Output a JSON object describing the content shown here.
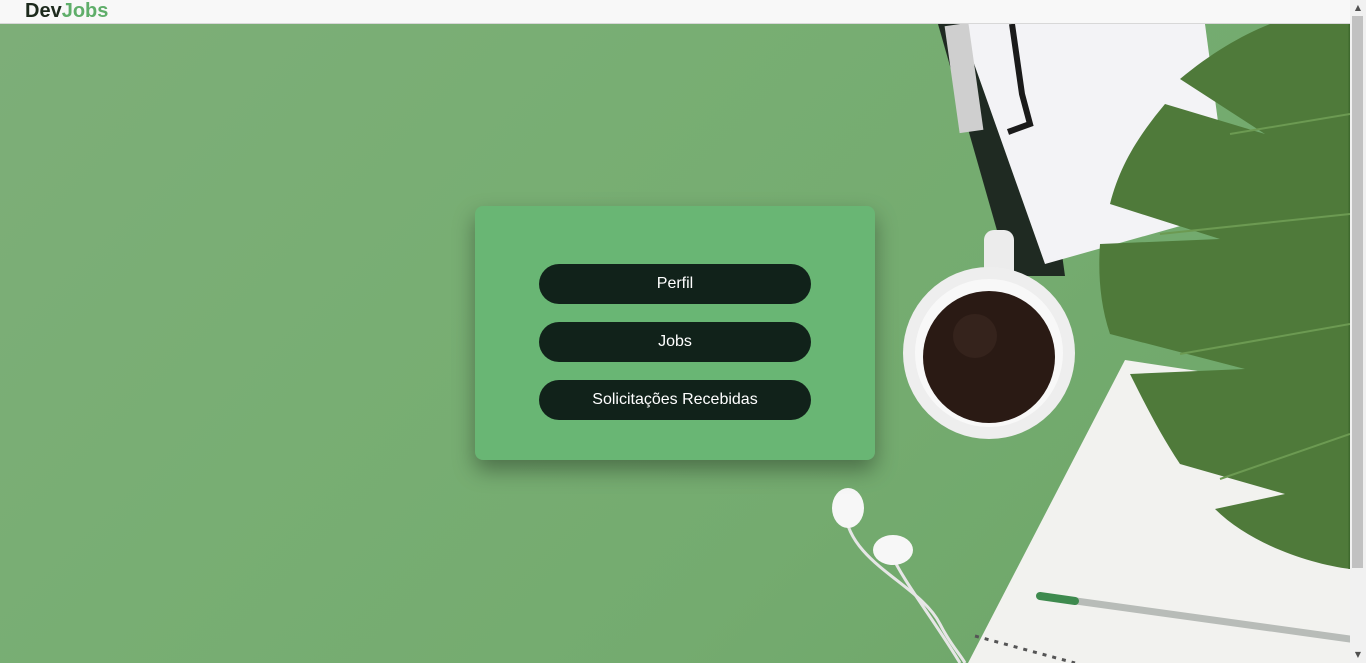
{
  "brand": {
    "part1": "Dev",
    "part2": "Jobs",
    "accent_color": "#5fae6a"
  },
  "menu": {
    "items": [
      {
        "label": "Perfil"
      },
      {
        "label": "Jobs"
      },
      {
        "label": "Solicitações Recebidas"
      }
    ]
  },
  "colors": {
    "background": "#78ae73",
    "card": "#69b674",
    "button": "#11221a"
  },
  "icons": {
    "scroll_up": "triangle-up",
    "scroll_down": "triangle-down"
  }
}
